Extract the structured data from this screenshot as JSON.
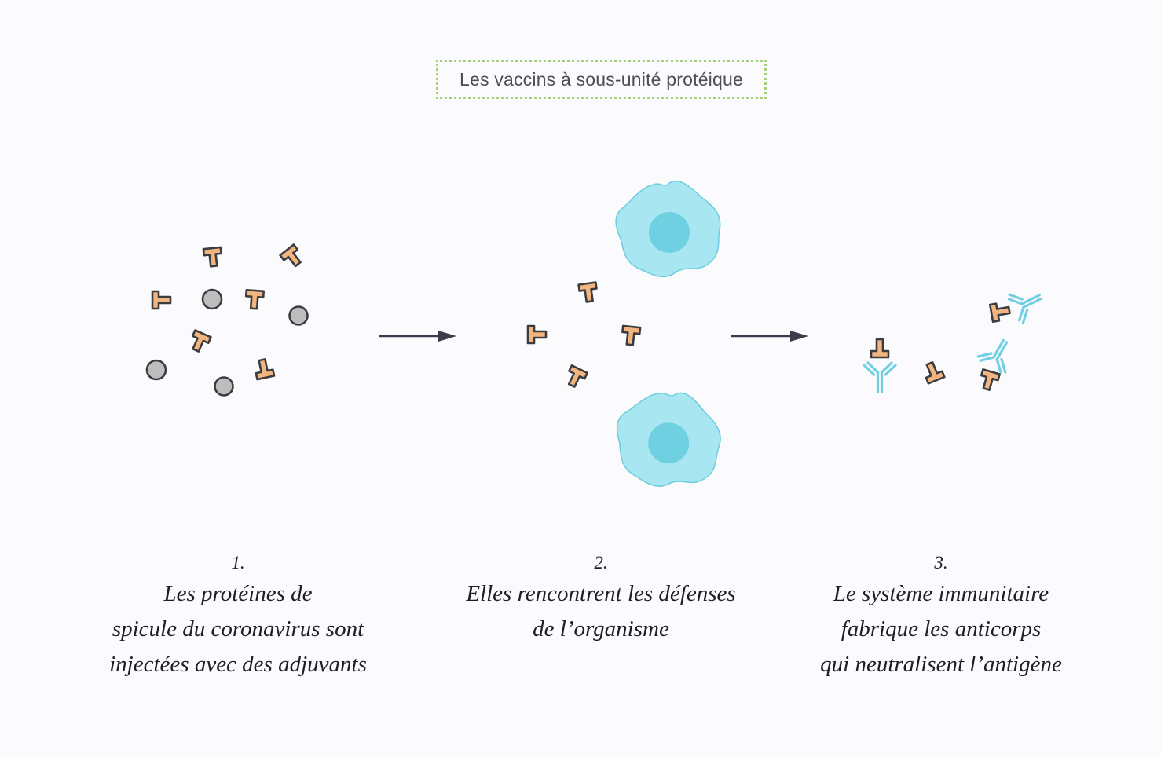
{
  "title": "Les vaccins à sous-unité protéique",
  "colors": {
    "protein": "#f3b57f",
    "outline": "#3a3c41",
    "adjuvant": "#bdbdbd",
    "cell": "#a8e6f1",
    "cell_outline": "#6ccde0",
    "nucleus": "#6fd0e2",
    "antibody": "#72cfe3",
    "arrow": "#3a3c4e",
    "frame": "#a6cf7c"
  },
  "icons": [
    "spike-protein-icon",
    "adjuvant-icon",
    "immune-cell-icon",
    "antibody-icon",
    "arrow-icon"
  ],
  "steps": [
    {
      "number": "1.",
      "lines": [
        "Les protéines de",
        "spicule du coronavirus sont",
        "injectées avec des adjuvants"
      ]
    },
    {
      "number": "2.",
      "lines": [
        "Elles rencontrent les défenses",
        "de l’organisme"
      ]
    },
    {
      "number": "3.",
      "lines": [
        "Le système immunitaire",
        "fabrique les anticorps",
        "qui neutralisent l’antigène"
      ]
    }
  ]
}
